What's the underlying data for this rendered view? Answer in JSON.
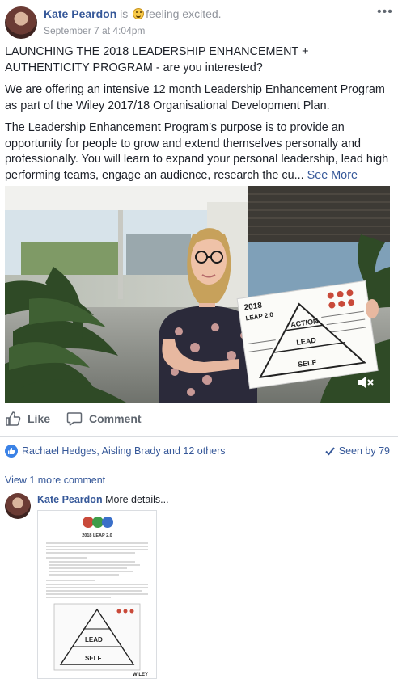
{
  "post": {
    "author": "Kate Peardon",
    "verb": "is",
    "feeling": "feeling excited.",
    "timestamp": "September 7 at 4:04pm",
    "options_icon": "more-horizontal-icon",
    "paragraphs": [
      "LAUNCHING THE 2018 LEADERSHIP ENHANCEMENT + AUTHENTICITY PROGRAM - are you interested?",
      "We are offering an intensive 12 month Leadership Enhancement Program as part of the Wiley 2017/18 Organisational Development Plan.",
      "The Leadership Enhancement Program’s purpose is to provide an opportunity for people to grow and extend themselves personally and professionally. You will learn to expand your personal leadership, lead high performing teams, engage an audience, research the cu..."
    ],
    "see_more": "See More"
  },
  "video": {
    "poster_text": {
      "title": "2018",
      "subtitle": "LEAP 2.0",
      "tiers": [
        "ACTION",
        "LEAD",
        "SELF"
      ]
    },
    "mute_icon": "volume-muted-icon"
  },
  "actions": {
    "like_label": "Like",
    "comment_label": "Comment"
  },
  "reactions": {
    "text": "Rachael Hedges, Aisling Brady and 12 others",
    "seen_label": "Seen by 79"
  },
  "comments": {
    "view_more": "View 1 more comment",
    "items": [
      {
        "author": "Kate Peardon",
        "text": "More details...",
        "attachment": "LEAP 2.0 program flyer"
      }
    ]
  },
  "attachment": {
    "heading": "2018 LEAP 2.0",
    "tiers": [
      "LEAD",
      "SELF"
    ],
    "footer": "WILEY"
  },
  "colors": {
    "link": "#365899",
    "muted": "#90949c",
    "text": "#1d2129",
    "divider": "#dadde1",
    "like_badge": "#3b82e6"
  }
}
